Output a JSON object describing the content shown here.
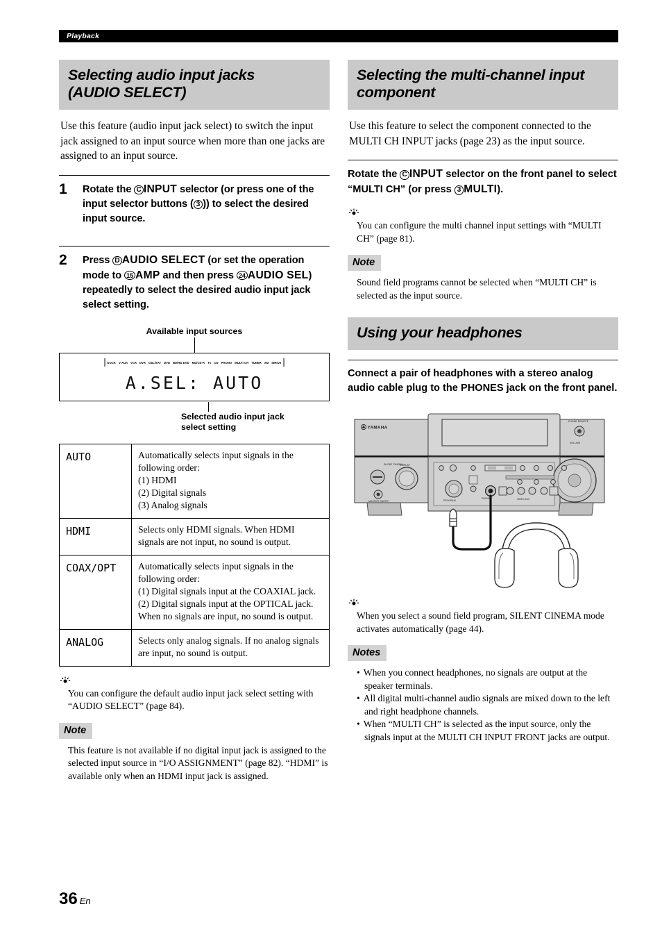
{
  "running_head": {
    "label": "Playback"
  },
  "footer": {
    "page_number": "36",
    "language": "En"
  },
  "left_column": {
    "section": {
      "title_line1": "Selecting audio input jacks",
      "title_line2": "(AUDIO SELECT)",
      "intro": "Use this feature (audio input jack select) to switch the input jack assigned to an input source when more than one jacks are assigned to an input source."
    },
    "steps": [
      {
        "number": "1",
        "parts": [
          {
            "type": "text",
            "value": "Rotate the "
          },
          {
            "type": "circle",
            "value": "C"
          },
          {
            "type": "kb",
            "value": "INPUT"
          },
          {
            "type": "text",
            "value": " selector (or press one of the input selector buttons ("
          },
          {
            "type": "circle",
            "value": "3"
          },
          {
            "type": "text",
            "value": ")) to select the desired input source."
          }
        ]
      },
      {
        "number": "2",
        "parts": [
          {
            "type": "text",
            "value": "Press "
          },
          {
            "type": "circle",
            "value": "D"
          },
          {
            "type": "kb",
            "value": "AUDIO SELECT"
          },
          {
            "type": "text",
            "value": " (or set the operation mode to "
          },
          {
            "type": "circle",
            "value": "15"
          },
          {
            "type": "kb",
            "value": "AMP"
          },
          {
            "type": "text",
            "value": " and then press "
          },
          {
            "type": "circle",
            "value": "24"
          },
          {
            "type": "kb",
            "value": "AUDIO SEL"
          },
          {
            "type": "text",
            "value": ") repeatedly to select the desired audio input jack select setting."
          }
        ]
      }
    ],
    "display_figure": {
      "caption_top": "Available input sources",
      "caption_bottom_line1": "Selected audio input jack",
      "caption_bottom_line2": "select setting",
      "input_sources": [
        "DOCK",
        "V-AUX",
        "VCR",
        "DVR",
        "CBL/SAT",
        "DVD",
        "BD/HD DVD",
        "MD/CD-R",
        "TV",
        "CD",
        "PHONO",
        "MULTI CH",
        "TUNER",
        "XM",
        "SIRIUS"
      ],
      "lcd_text": "A.SEL:  AUTO"
    },
    "options_table": [
      {
        "key": "AUTO",
        "value": "Automatically selects input signals in the following order:\n(1) HDMI\n(2) Digital signals\n(3) Analog signals"
      },
      {
        "key": "HDMI",
        "value": "Selects only HDMI signals. When HDMI signals are not input, no sound is output."
      },
      {
        "key": "COAX/OPT",
        "value": "Automatically selects input signals in the following order:\n(1) Digital signals input at the COAXIAL jack.\n(2) Digital signals input at the OPTICAL jack.\nWhen no signals are input, no sound is output."
      },
      {
        "key": "ANALOG",
        "value": "Selects only analog signals. If no analog signals are input, no sound is output."
      }
    ],
    "tip": {
      "text": "You can configure the default audio input jack select setting with “AUDIO SELECT” (page 84)."
    },
    "note": {
      "tag": "Note",
      "text": "This feature is not available if no digital input jack is assigned to the selected input source in “I/O ASSIGNMENT” (page 82). “HDMI” is available only when an HDMI input jack is assigned."
    }
  },
  "right_column": {
    "section_multich": {
      "title_line1": "Selecting the multi-channel input",
      "title_line2": "component",
      "intro": "Use this feature to select the component connected to the MULTI CH INPUT jacks (page 23) as the input source.",
      "instruction_parts": [
        {
          "type": "text",
          "value": "Rotate the "
        },
        {
          "type": "circle",
          "value": "C"
        },
        {
          "type": "kb",
          "value": "INPUT"
        },
        {
          "type": "text",
          "value": " selector on the front panel to select “MULTI CH” (or press "
        },
        {
          "type": "circle",
          "value": "3"
        },
        {
          "type": "kb",
          "value": "MULTI"
        },
        {
          "type": "text",
          "value": ")."
        }
      ],
      "tip": "You can configure the multi channel input settings with “MULTI CH” (page 81).",
      "note_tag": "Note",
      "note": "Sound field programs cannot be selected when “MULTI CH” is selected as the input source."
    },
    "section_headphones": {
      "title": "Using your headphones",
      "instruction": "Connect a pair of headphones with a stereo analog audio cable plug to the PHONES jack on the front panel.",
      "receiver_brand": "YAMAHA",
      "tip": "When you select a sound field program, SILENT CINEMA mode activates automatically (page 44).",
      "notes_tag": "Notes",
      "notes": [
        "When you connect headphones, no signals are output at the speaker terminals.",
        "All digital multi-channel audio signals are mixed down to the left and right headphone channels.",
        "When “MULTI CH” is selected as the input source, only the signals input at the MULTI CH INPUT FRONT jacks are output."
      ]
    }
  },
  "colors": {
    "banner_gray": "#c9c9c9",
    "tag_gray": "#d2d2d2",
    "runhead_black": "#000000",
    "panel_gray": "#cfcfcf"
  }
}
